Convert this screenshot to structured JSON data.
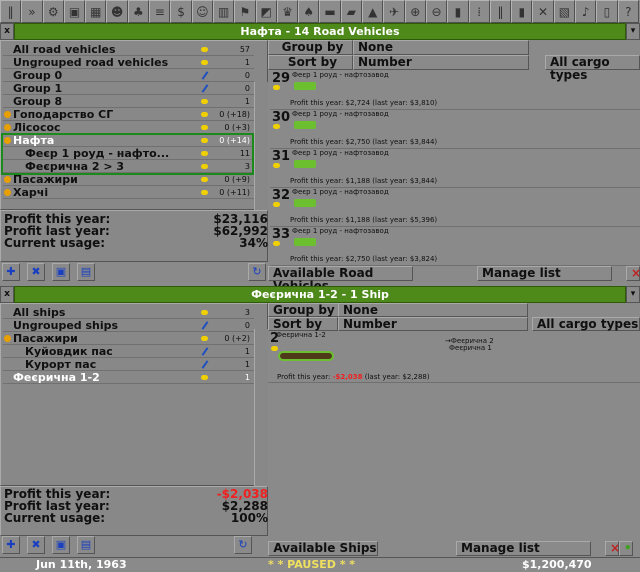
{
  "toolbar": {
    "icons": [
      "pause-icon",
      "fast-forward-icon",
      "settings-icon",
      "save-icon",
      "map-icon",
      "town-icon",
      "subsidies-icon",
      "stations-icon",
      "finances-icon",
      "company-icon",
      "story-icon",
      "goals-icon",
      "graphs-icon",
      "league-icon",
      "industry-icon",
      "trains-icon",
      "road-vehicles-icon",
      "ships-icon",
      "aircraft-icon",
      "zoom-in-icon",
      "zoom-out-icon",
      "build-rail-icon",
      "build-road-icon",
      "build-tram-icon",
      "build-water-icon",
      "build-air-icon",
      "landscaping-icon",
      "sound-icon",
      "messages-icon",
      "help-icon"
    ]
  },
  "road_window": {
    "title": "Нафта - 14 Road Vehicles",
    "close": "x",
    "groups": [
      {
        "label": "All road vehicles",
        "count": "57"
      },
      {
        "label": "Ungrouped road vehicles",
        "count": "1"
      },
      {
        "label": "Group 0",
        "count": "0"
      },
      {
        "label": "Group 1",
        "count": "0"
      },
      {
        "label": "Group 8",
        "count": "1"
      },
      {
        "label": "Гоподарство СГ",
        "count": "0 (+18)"
      },
      {
        "label": "Лісосос",
        "count": "0 (+3)"
      },
      {
        "label": "Нафта",
        "count": "0 (+14)"
      },
      {
        "label": "Феєр 1 роуд - нафто...",
        "count": "11"
      },
      {
        "label": "Феєрична 2 > 3",
        "count": "3"
      },
      {
        "label": "Пасажири",
        "count": "0 (+9)"
      },
      {
        "label": "Харчі",
        "count": "0 (+11)"
      }
    ],
    "profit_this_year_label": "Profit this year:",
    "profit_this_year": "$23,116",
    "profit_last_year_label": "Profit last year:",
    "profit_last_year": "$62,992",
    "usage_label": "Current usage:",
    "usage": "34%",
    "group_by_label": "Group by",
    "group_by_value": "None",
    "sort_by_label": "Sort by",
    "sort_by_value": "Number",
    "cargo_filter": "All cargo types",
    "vehicles": [
      {
        "num": "29",
        "name": "Феєр 1 роуд - нафтозавод",
        "profit": "Profit this year: $2,724 (last year: $3,810)"
      },
      {
        "num": "30",
        "name": "Феєр 1 роуд - нафтозавод",
        "profit": "Profit this year: $2,750 (last year: $3,844)"
      },
      {
        "num": "31",
        "name": "Феєр 1 роуд - нафтозавод",
        "profit": "Profit this year: $1,188 (last year: $3,844)"
      },
      {
        "num": "32",
        "name": "Феєр 1 роуд - нафтозавод",
        "profit": "Profit this year: $1,188 (last year: $5,396)"
      },
      {
        "num": "33",
        "name": "Феєр 1 роуд - нафтозавод",
        "profit": "Profit this year: $2,750 (last year: $3,824)"
      }
    ],
    "available_label": "Available Road Vehicles",
    "manage_label": "Manage list"
  },
  "ship_window": {
    "title": "Феєрична 1-2 - 1 Ship",
    "close": "x",
    "groups": [
      {
        "label": "All ships",
        "count": "3"
      },
      {
        "label": "Ungrouped ships",
        "count": "0"
      },
      {
        "label": "Пасажири",
        "count": "0 (+2)"
      },
      {
        "label": "Куйовдик пас",
        "count": "1"
      },
      {
        "label": "Курорт пас",
        "count": "1"
      },
      {
        "label": "Феєрична 1-2",
        "count": "1"
      }
    ],
    "profit_this_year_label": "Profit this year:",
    "profit_this_year": "-$2,038",
    "profit_last_year_label": "Profit last year:",
    "profit_last_year": "$2,288",
    "usage_label": "Current usage:",
    "usage": "100%",
    "group_by_label": "Group by",
    "group_by_value": "None",
    "sort_by_label": "Sort by",
    "sort_by_value": "Number",
    "cargo_filter": "All cargo types",
    "vehicle": {
      "num": "2",
      "name": "Феєрична 1-2",
      "order1": "→Феєрична 2",
      "order2": "Феєрична 1",
      "profit_prefix": "Profit this year:",
      "profit_value": "-$2,038",
      "profit_suffix": "(last year: $2,288)"
    },
    "available_label": "Available Ships",
    "manage_label": "Manage list"
  },
  "status": {
    "date": "Jun 11th, 1963",
    "paused": "* * PAUSED * *",
    "money": "$1,200,470"
  },
  "colors": {
    "title_green": "#4e8a1a",
    "negative": "#f02020",
    "paused": "#f0e060"
  }
}
